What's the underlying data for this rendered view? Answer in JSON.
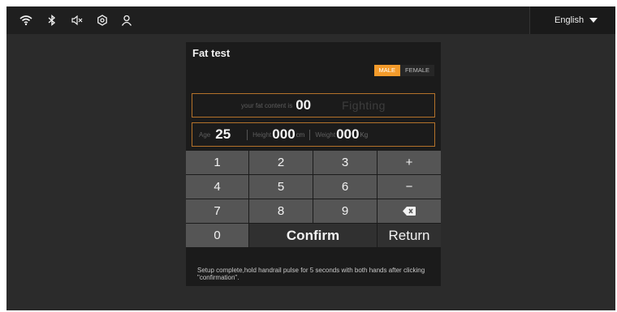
{
  "status_bar": {
    "icons": [
      "wifi-icon",
      "bluetooth-icon",
      "speaker-muted-icon",
      "settings-icon",
      "user-icon"
    ],
    "language": "English"
  },
  "panel": {
    "title": "Fat test",
    "gender": {
      "male": "MALE",
      "female": "FEMALE",
      "selected": "MALE"
    },
    "result": {
      "prefix": "your fat content is",
      "value": "00",
      "hint": "Fighting"
    },
    "inputs": {
      "age_label": "Age",
      "age_value": "25",
      "height_label": "Height",
      "height_value": "000",
      "height_unit": "cm",
      "weight_label": "Weight",
      "weight_value": "000",
      "weight_unit": "Kg"
    },
    "keypad": {
      "row1": [
        "1",
        "2",
        "3",
        "+"
      ],
      "row2": [
        "4",
        "5",
        "6",
        "−"
      ],
      "row3": [
        "7",
        "8",
        "9"
      ],
      "backspace_icon": "backspace-icon",
      "zero": "0",
      "confirm": "Confirm",
      "return": "Return"
    },
    "instruction": "Setup complete,hold handrail pulse for 5 seconds with both hands after clicking \"confirmation\"."
  },
  "colors": {
    "accent": "#f39b2b",
    "border": "#b4722a",
    "key": "#555555",
    "background": "#2b2b2b"
  }
}
